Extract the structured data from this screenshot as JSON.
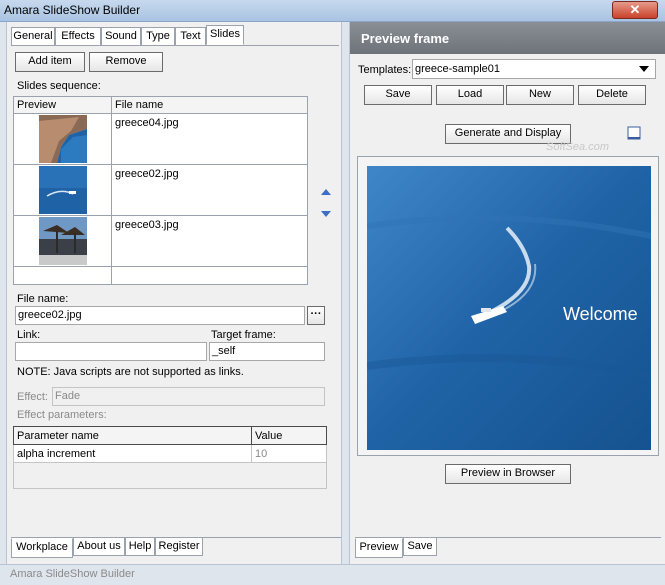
{
  "window": {
    "title": "Amara SlideShow Builder"
  },
  "left": {
    "tabs": [
      "General",
      "Effects",
      "Sound",
      "Type",
      "Text",
      "Slides"
    ],
    "active_tab": "Slides",
    "add_item_label": "Add item",
    "remove_label": "Remove",
    "slides_sequence_label": "Slides sequence:",
    "table_headers": [
      "Preview",
      "File name"
    ],
    "slides": [
      {
        "file": "greece04.jpg"
      },
      {
        "file": "greece02.jpg"
      },
      {
        "file": "greece03.jpg"
      }
    ],
    "file_name_label": "File name:",
    "file_name_value": "greece02.jpg",
    "browse_label": "···",
    "link_label": "Link:",
    "link_value": "",
    "target_frame_label": "Target frame:",
    "target_frame_value": "_self",
    "note": "NOTE: Java scripts are not supported as links.",
    "effect_label": "Effect:",
    "effect_value": "Fade",
    "effect_params_label": "Effect parameters:",
    "param_headers": [
      "Parameter name",
      "Value"
    ],
    "params": [
      {
        "name": "alpha increment",
        "value": "10"
      }
    ],
    "bottom_tabs": [
      "Workplace",
      "About us",
      "Help",
      "Register"
    ]
  },
  "right": {
    "header": "Preview frame",
    "templates_label": "Templates:",
    "template_value": "greece-sample01",
    "buttons": {
      "save": "Save",
      "load": "Load",
      "new": "New",
      "delete": "Delete"
    },
    "generate_label": "Generate and Display",
    "watermark": "SoftSea.com",
    "welcome_text": "Welcome",
    "preview_browser_label": "Preview in Browser",
    "bottom_tabs": [
      "Preview",
      "Save"
    ]
  },
  "status": {
    "text": "Amara SlideShow Builder"
  },
  "colors": {
    "sea": "#1f63a6",
    "header": "#767b82"
  }
}
